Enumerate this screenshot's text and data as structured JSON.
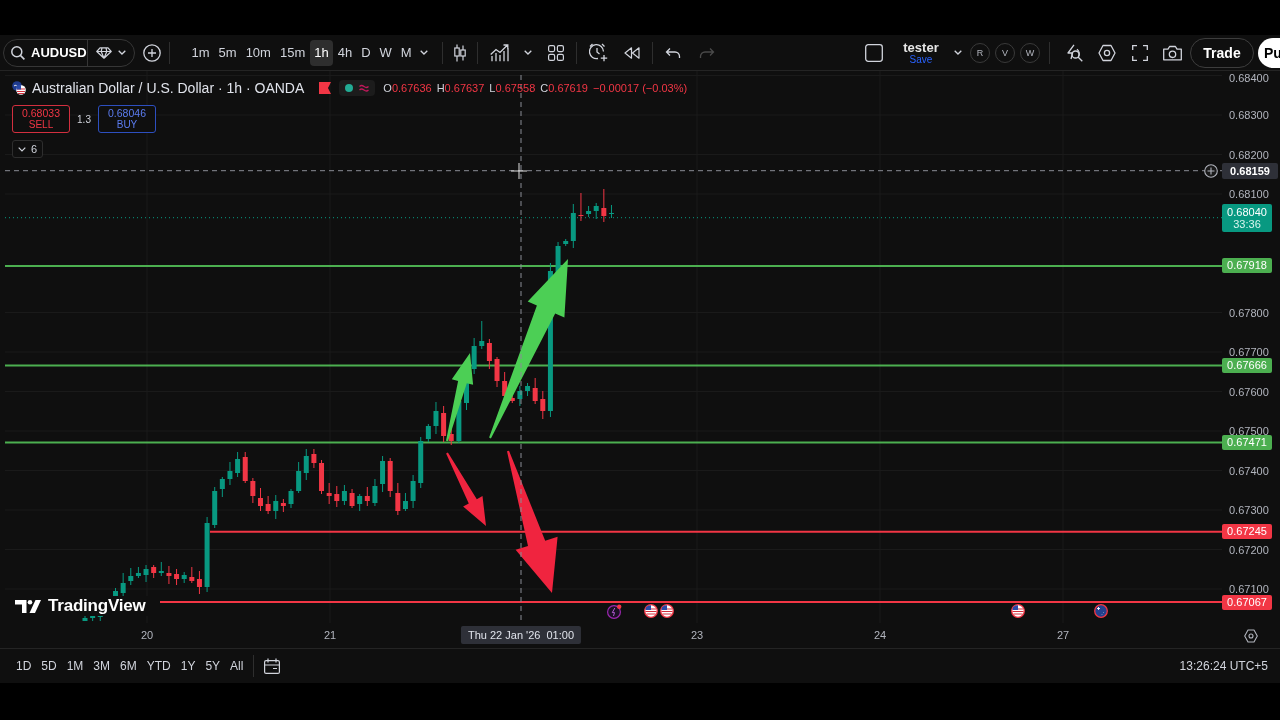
{
  "toolbar": {
    "symbol": "AUDUSD",
    "timeframes": [
      {
        "label": "1m",
        "selected": false
      },
      {
        "label": "5m",
        "selected": false
      },
      {
        "label": "10m",
        "selected": false
      },
      {
        "label": "15m",
        "selected": false
      },
      {
        "label": "1h",
        "selected": true
      },
      {
        "label": "4h",
        "selected": false
      },
      {
        "label": "D",
        "selected": false
      },
      {
        "label": "W",
        "selected": false
      },
      {
        "label": "M",
        "selected": false
      }
    ],
    "history": [
      {
        "kind": "undo",
        "disabled": false
      },
      {
        "kind": "redo",
        "disabled": true
      }
    ],
    "layout": {
      "name": "tester",
      "action": "Save"
    },
    "chips": [
      "R",
      "V",
      "W"
    ],
    "trade_button": "Trade",
    "publish_button": "Pu"
  },
  "legend": {
    "title": "Australian Dollar / U.S. Dollar · 1h · OANDA",
    "falling": true,
    "ohlc": [
      {
        "label": "O",
        "value": "0.67636"
      },
      {
        "label": "H",
        "value": "0.67637"
      },
      {
        "label": "L",
        "value": "0.67558"
      },
      {
        "label": "C",
        "value": "0.67619"
      }
    ],
    "change": "−0.00017 (−0.03%)"
  },
  "order_panel": {
    "sell": {
      "price": "0.68033",
      "label": "SELL"
    },
    "spread": "1.3",
    "buy": {
      "price": "0.68046",
      "label": "BUY"
    }
  },
  "indicators_toggle": {
    "count": "6"
  },
  "price_scale": {
    "ticks": [
      "0.68400",
      "0.68300",
      "0.68200",
      "0.68100",
      "0.67800",
      "0.67700",
      "0.67600",
      "0.67500",
      "0.67400",
      "0.67300",
      "0.67200",
      "0.67100"
    ],
    "crosshair_price": "0.68159",
    "last_price": "0.68040",
    "countdown": "33:36"
  },
  "horizontal_lines": [
    {
      "price": "0.67918",
      "color": "#4caf50"
    },
    {
      "price": "0.67666",
      "color": "#4caf50"
    },
    {
      "price": "0.67471",
      "color": "#4caf50"
    },
    {
      "price": "0.67245",
      "color": "#f23645"
    },
    {
      "price": "0.67067",
      "color": "#f23645"
    }
  ],
  "logo": "TradingView",
  "time_scale": {
    "labels": [
      "20",
      "21",
      "23",
      "24",
      "27"
    ],
    "crosshair_time": "Thu 22 Jan '26  01:00"
  },
  "bottom_bar": {
    "ranges": [
      "1D",
      "5D",
      "1M",
      "3M",
      "6M",
      "YTD",
      "1Y",
      "5Y",
      "All"
    ],
    "clock": "13:26:24 UTC+5"
  }
}
